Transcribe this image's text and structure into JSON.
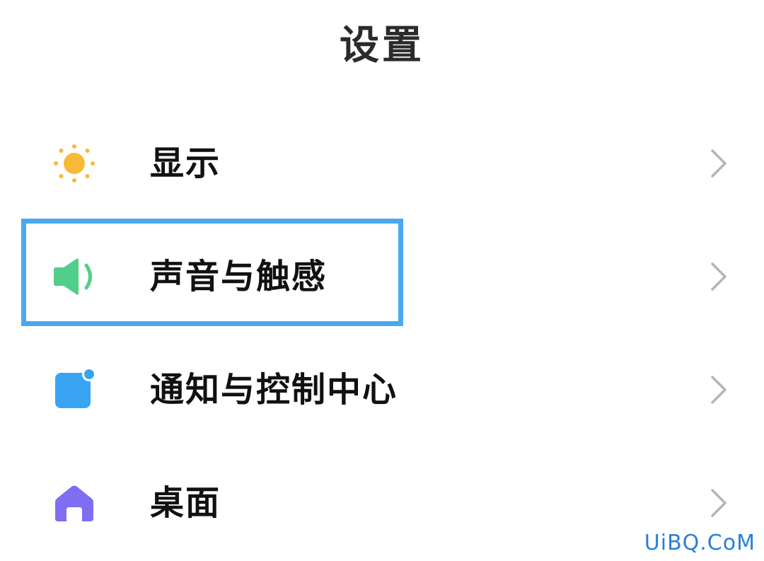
{
  "header": {
    "title": "设置"
  },
  "items": [
    {
      "label": "显示",
      "icon": "sun-icon",
      "color": "#f8b936"
    },
    {
      "label": "声音与触感",
      "icon": "speaker-icon",
      "color": "#4fcf8a"
    },
    {
      "label": "通知与控制中心",
      "icon": "notification-icon",
      "color": "#3aa4f4"
    },
    {
      "label": "桌面",
      "icon": "home-icon",
      "color": "#7f6df2"
    }
  ],
  "watermark": "UiBQ.CoM",
  "highlight_color": "#4aa8f0"
}
